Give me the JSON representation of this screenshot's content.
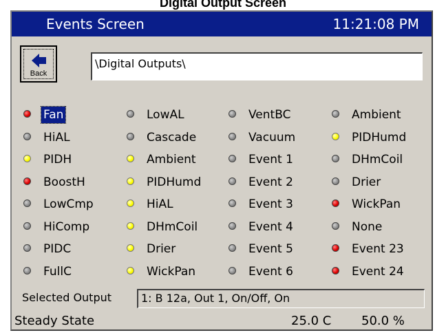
{
  "document_title": "Digital Output Screen",
  "titlebar": {
    "title": "Events Screen",
    "time": "11:21:08 PM"
  },
  "back_button": {
    "label": "Back"
  },
  "path": "\\Digital Outputs\\",
  "outputs": [
    [
      {
        "label": "Fan",
        "state": "red",
        "selected": true
      },
      {
        "label": "HiAL",
        "state": "gray"
      },
      {
        "label": "PIDH",
        "state": "yellow"
      },
      {
        "label": "BoostH",
        "state": "red"
      },
      {
        "label": "LowCmp",
        "state": "gray"
      },
      {
        "label": "HiComp",
        "state": "gray"
      },
      {
        "label": "PIDC",
        "state": "gray"
      },
      {
        "label": "FullC",
        "state": "gray"
      }
    ],
    [
      {
        "label": "LowAL",
        "state": "gray"
      },
      {
        "label": "Cascade",
        "state": "gray"
      },
      {
        "label": "Ambient",
        "state": "yellow"
      },
      {
        "label": "PIDHumd",
        "state": "yellow"
      },
      {
        "label": "HiAL",
        "state": "yellow"
      },
      {
        "label": "DHmCoil",
        "state": "yellow"
      },
      {
        "label": "Drier",
        "state": "yellow"
      },
      {
        "label": "WickPan",
        "state": "yellow"
      }
    ],
    [
      {
        "label": "VentBC",
        "state": "gray"
      },
      {
        "label": "Vacuum",
        "state": "gray"
      },
      {
        "label": "Event 1",
        "state": "gray"
      },
      {
        "label": "Event 2",
        "state": "gray"
      },
      {
        "label": "Event 3",
        "state": "gray"
      },
      {
        "label": "Event 4",
        "state": "gray"
      },
      {
        "label": "Event 5",
        "state": "gray"
      },
      {
        "label": "Event 6",
        "state": "gray"
      }
    ],
    [
      {
        "label": "Ambient",
        "state": "gray"
      },
      {
        "label": "PIDHumd",
        "state": "yellow"
      },
      {
        "label": "DHmCoil",
        "state": "gray"
      },
      {
        "label": "Drier",
        "state": "gray"
      },
      {
        "label": "WickPan",
        "state": "red"
      },
      {
        "label": "None",
        "state": "gray"
      },
      {
        "label": "Event 23",
        "state": "red"
      },
      {
        "label": "Event 24",
        "state": "red"
      }
    ]
  ],
  "selected_output": {
    "label": "Selected Output",
    "value": "1: B 12a, Out 1, On/Off, On"
  },
  "status": {
    "state": "Steady State",
    "temperature": "25.0 C",
    "humidity": "50.0 %"
  },
  "colors": {
    "titlebar": "#0a1e8a",
    "panel": "#d4d0c8",
    "on_red": "#e00000",
    "on_yellow": "#ffff00",
    "off_gray": "#909090"
  }
}
